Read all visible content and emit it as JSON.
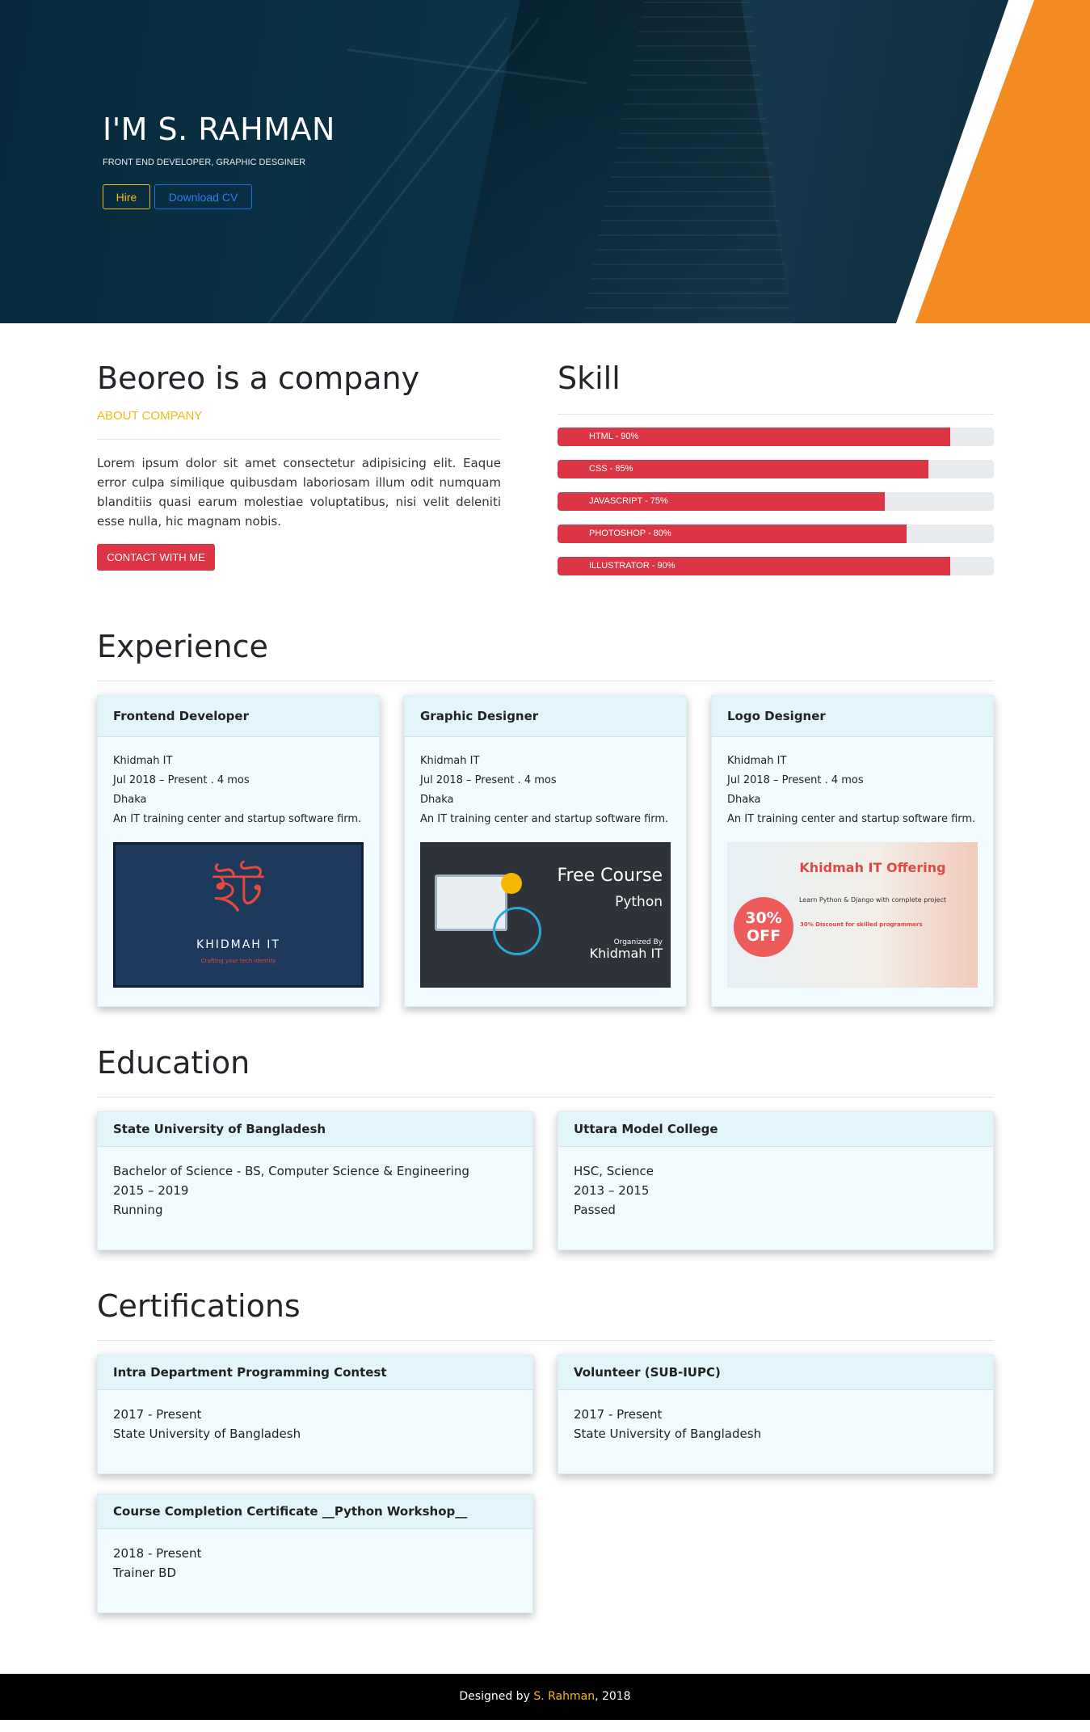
{
  "hero": {
    "title": "I'M S. RAHMAN",
    "subtitle": "FRONT END DEVELOPER, GRAPHIC DESGINER",
    "hire_label": "Hire",
    "cv_label": "Download CV"
  },
  "about": {
    "title": "Beoreo is a company",
    "subtitle": "ABOUT COMPANY",
    "text": "Lorem ipsum dolor sit amet consectetur adipisicing elit. Eaque error culpa similique quibusdam laboriosam illum odit numquam blanditiis quasi earum molestiae voluptatibus, nisi velit deleniti esse nulla, hic magnam nobis.",
    "contact_label": "CONTACT WITH ME"
  },
  "skills": {
    "title": "Skill",
    "items": [
      {
        "label": "HTML - 90%",
        "percent": 90
      },
      {
        "label": "CSS - 85%",
        "percent": 85
      },
      {
        "label": "JAVASCRIPT - 75%",
        "percent": 75
      },
      {
        "label": "PHOTOSHOP - 80%",
        "percent": 80
      },
      {
        "label": "ILLUSTRATOR - 90%",
        "percent": 90
      }
    ]
  },
  "experience": {
    "title": "Experience",
    "cards": [
      {
        "title": "Frontend Developer",
        "company": "Khidmah IT",
        "period": "Jul 2018 – Present . 4 mos",
        "location": "Dhaka",
        "description": "An IT training center and startup software firm."
      },
      {
        "title": "Graphic Designer",
        "company": "Khidmah IT",
        "period": "Jul 2018 – Present . 4 mos",
        "location": "Dhaka",
        "description": "An IT training center and startup software firm."
      },
      {
        "title": "Logo Designer",
        "company": "Khidmah IT",
        "period": "Jul 2018 – Present . 4 mos",
        "location": "Dhaka",
        "description": "An IT training center and startup software firm."
      }
    ],
    "thumb1": {
      "logo_glyph": "ইট",
      "brand": "KHIDMAH IT",
      "tagline": "Crafting your tech identity"
    },
    "thumb2": {
      "line1": "Free Course",
      "line2": "Python",
      "line3": "Organized By",
      "line4": "Khidmah IT"
    },
    "thumb3": {
      "heading": "Khidmah IT Offering",
      "line1": "Learn Python & Django with complete project",
      "badge_top": "30%",
      "badge_bottom": "OFF",
      "line2": "30% Discount for skilled programmers"
    }
  },
  "education": {
    "title": "Education",
    "cards": [
      {
        "title": "State University of Bangladesh",
        "degree": "Bachelor of Science - BS, Computer Science & Engineering",
        "years": "2015 – 2019",
        "status": "Running"
      },
      {
        "title": "Uttara Model College",
        "degree": "HSC, Science",
        "years": "2013 – 2015",
        "status": "Passed"
      }
    ]
  },
  "certifications": {
    "title": "Certifications",
    "cards": [
      {
        "title": "Intra Department Programming Contest",
        "period": "2017 - Present",
        "org": "State University of Bangladesh"
      },
      {
        "title": "Volunteer (SUB-IUPC)",
        "period": "2017 - Present",
        "org": "State University of Bangladesh"
      },
      {
        "title": "Course Completion Certificate __Python Workshop__",
        "period": "2018 - Present",
        "org": "Trainer BD"
      }
    ]
  },
  "footer": {
    "prefix": "Designed by ",
    "name": "S. Rahman",
    "suffix": ", 2018"
  },
  "colors": {
    "accent_red": "#dc3545",
    "accent_yellow": "#f0b91d",
    "accent_orange": "#f28c22",
    "hero_bg": "#062a3b",
    "card_bg": "#f2fbfd"
  }
}
